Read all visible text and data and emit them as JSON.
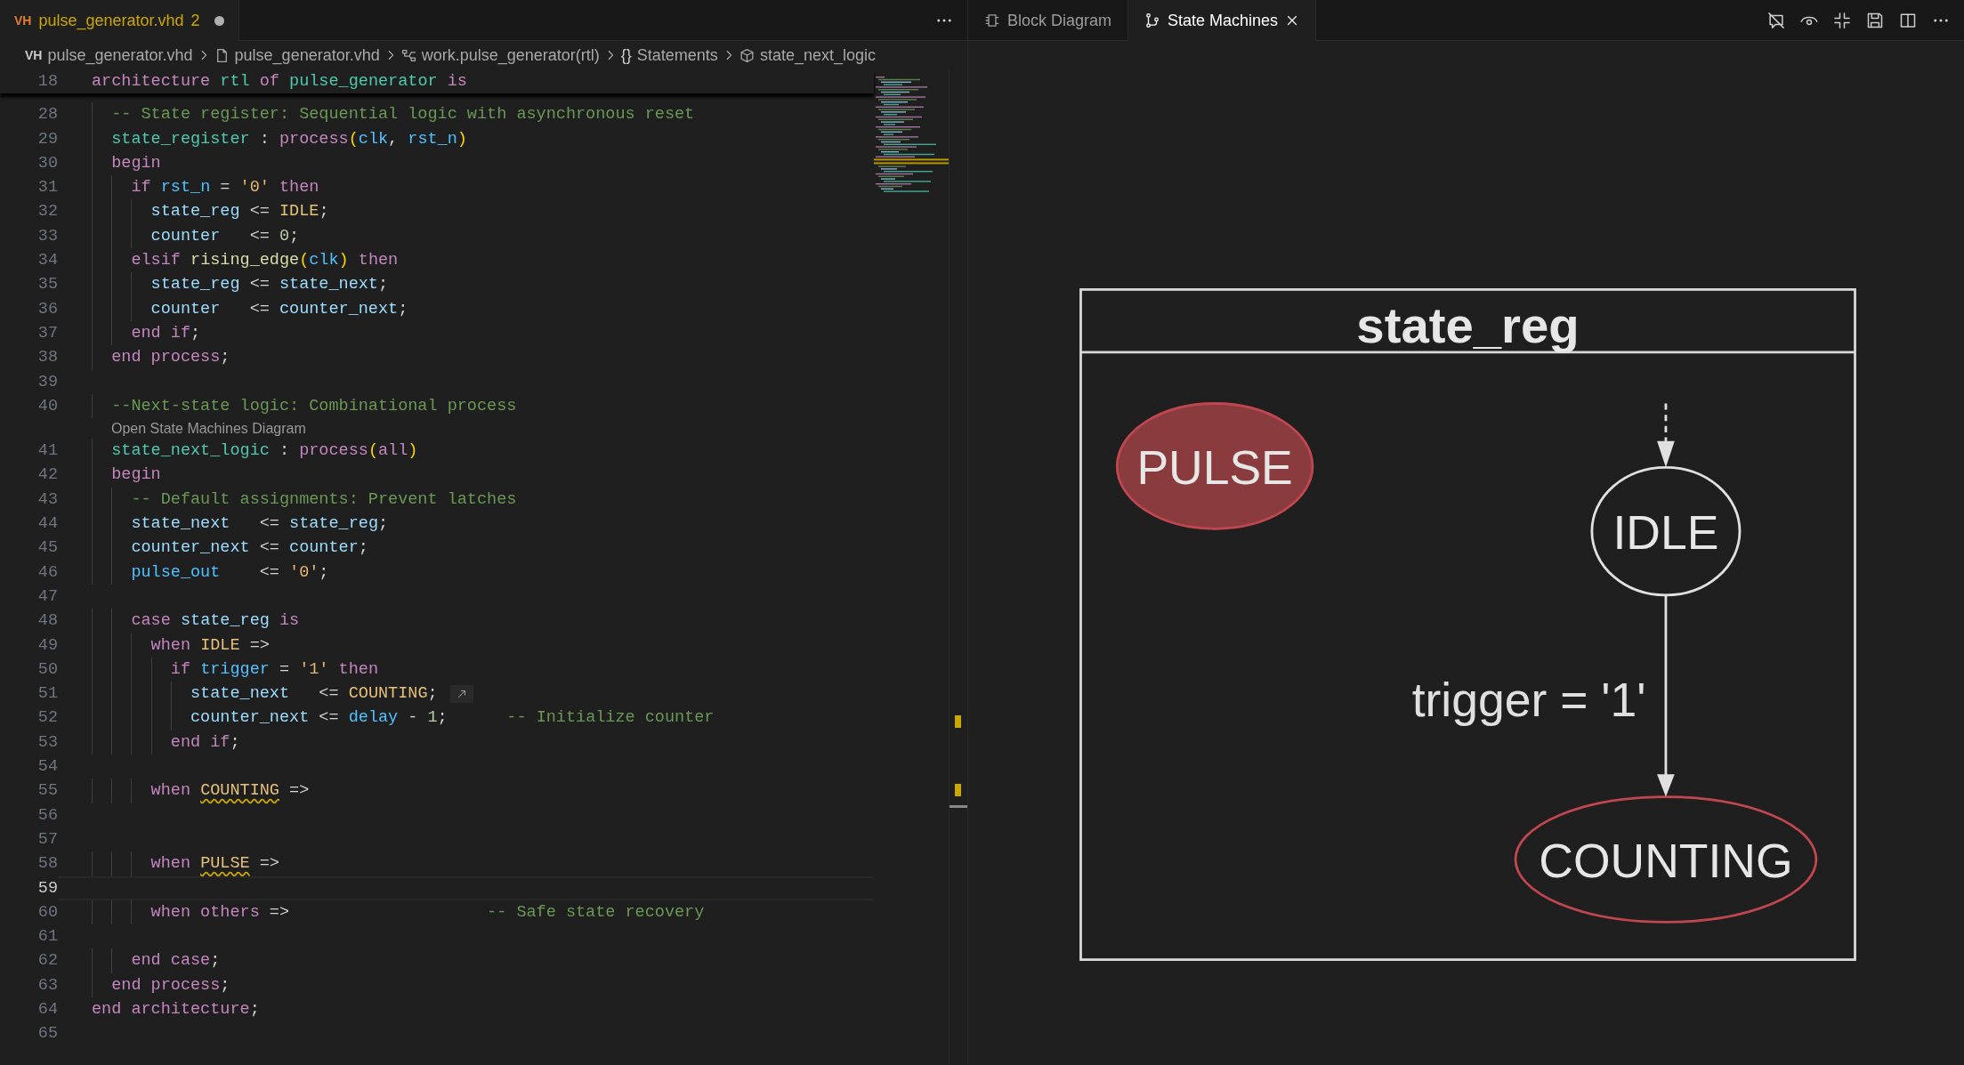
{
  "editor": {
    "tab": {
      "prefix": "VH",
      "title": "pulse_generator.vhd",
      "problems": "2",
      "modified": true,
      "selected": true
    },
    "breadcrumbs": [
      {
        "prefix": "VH",
        "label": "pulse_generator.vhd"
      },
      {
        "label": "pulse_generator.vhd"
      },
      {
        "label": "work.pulse_generator(rtl)"
      },
      {
        "prefix": "{}",
        "label": "Statements"
      },
      {
        "label": "state_next_logic"
      }
    ],
    "sticky_line": {
      "number": "18",
      "tokens": [
        {
          "kind": "kw",
          "text": "architecture "
        },
        {
          "kind": "name",
          "text": "rtl "
        },
        {
          "kind": "kw",
          "text": "of "
        },
        {
          "kind": "name",
          "text": "pulse_generator "
        },
        {
          "kind": "kw",
          "text": "is"
        }
      ]
    },
    "lines": [
      {
        "kind": "code",
        "number": "28",
        "tokens": [
          {
            "kind": "comment",
            "text": "  -- State register: Sequential logic with asynchronous reset"
          }
        ]
      },
      {
        "kind": "code",
        "number": "29",
        "tokens": [
          {
            "kind": "name",
            "text": "  state_register"
          },
          {
            "kind": "op",
            "text": " : "
          },
          {
            "kind": "kw",
            "text": "process"
          },
          {
            "kind": "paren",
            "text": "("
          },
          {
            "kind": "port",
            "text": "clk"
          },
          {
            "kind": "op",
            "text": ", "
          },
          {
            "kind": "port",
            "text": "rst_n"
          },
          {
            "kind": "paren",
            "text": ")"
          }
        ]
      },
      {
        "kind": "code",
        "number": "30",
        "tokens": [
          {
            "kind": "kw",
            "text": "  begin"
          }
        ]
      },
      {
        "kind": "code",
        "number": "31",
        "tokens": [
          {
            "kind": "kw",
            "text": "    if "
          },
          {
            "kind": "port",
            "text": "rst_n"
          },
          {
            "kind": "op",
            "text": " = "
          },
          {
            "kind": "lit",
            "text": "'0'"
          },
          {
            "kind": "kw",
            "text": " then"
          }
        ]
      },
      {
        "kind": "code",
        "number": "32",
        "tokens": [
          {
            "kind": "var",
            "text": "      state_reg"
          },
          {
            "kind": "op",
            "text": " <= "
          },
          {
            "kind": "const",
            "text": "IDLE"
          },
          {
            "kind": "op",
            "text": ";"
          }
        ]
      },
      {
        "kind": "code",
        "number": "33",
        "tokens": [
          {
            "kind": "var",
            "text": "      counter"
          },
          {
            "kind": "op",
            "text": "   <= "
          },
          {
            "kind": "num",
            "text": "0"
          },
          {
            "kind": "op",
            "text": ";"
          }
        ]
      },
      {
        "kind": "code",
        "number": "34",
        "tokens": [
          {
            "kind": "kw",
            "text": "    elsif "
          },
          {
            "kind": "func",
            "text": "rising_edge"
          },
          {
            "kind": "paren",
            "text": "("
          },
          {
            "kind": "port",
            "text": "clk"
          },
          {
            "kind": "paren",
            "text": ")"
          },
          {
            "kind": "kw",
            "text": " then"
          }
        ]
      },
      {
        "kind": "code",
        "number": "35",
        "tokens": [
          {
            "kind": "var",
            "text": "      state_reg"
          },
          {
            "kind": "op",
            "text": " <= "
          },
          {
            "kind": "var",
            "text": "state_next"
          },
          {
            "kind": "op",
            "text": ";"
          }
        ]
      },
      {
        "kind": "code",
        "number": "36",
        "tokens": [
          {
            "kind": "var",
            "text": "      counter"
          },
          {
            "kind": "op",
            "text": "   <= "
          },
          {
            "kind": "var",
            "text": "counter_next"
          },
          {
            "kind": "op",
            "text": ";"
          }
        ]
      },
      {
        "kind": "code",
        "number": "37",
        "tokens": [
          {
            "kind": "kw",
            "text": "    end if"
          },
          {
            "kind": "op",
            "text": ";"
          }
        ]
      },
      {
        "kind": "code",
        "number": "38",
        "tokens": [
          {
            "kind": "kw",
            "text": "  end process"
          },
          {
            "kind": "op",
            "text": ";"
          }
        ]
      },
      {
        "kind": "code",
        "number": "39"
      },
      {
        "kind": "code",
        "number": "40",
        "tokens": [
          {
            "kind": "comment",
            "text": "  --Next-state logic: Combinational process"
          }
        ]
      },
      {
        "kind": "codelens",
        "text": "Open State Machines Diagram"
      },
      {
        "kind": "code",
        "number": "41",
        "tokens": [
          {
            "kind": "name",
            "text": "  state_next_logic"
          },
          {
            "kind": "op",
            "text": " : "
          },
          {
            "kind": "kw",
            "text": "process"
          },
          {
            "kind": "paren",
            "text": "("
          },
          {
            "kind": "kw",
            "text": "all"
          },
          {
            "kind": "paren",
            "text": ")"
          }
        ]
      },
      {
        "kind": "code",
        "number": "42",
        "tokens": [
          {
            "kind": "kw",
            "text": "  begin"
          }
        ]
      },
      {
        "kind": "code",
        "number": "43",
        "tokens": [
          {
            "kind": "comment",
            "text": "    -- Default assignments: Prevent latches"
          }
        ]
      },
      {
        "kind": "code",
        "number": "44",
        "tokens": [
          {
            "kind": "var",
            "text": "    state_next"
          },
          {
            "kind": "op",
            "text": "   <= "
          },
          {
            "kind": "var",
            "text": "state_reg"
          },
          {
            "kind": "op",
            "text": ";"
          }
        ]
      },
      {
        "kind": "code",
        "number": "45",
        "tokens": [
          {
            "kind": "var",
            "text": "    counter_next"
          },
          {
            "kind": "op",
            "text": " <= "
          },
          {
            "kind": "var",
            "text": "counter"
          },
          {
            "kind": "op",
            "text": ";"
          }
        ]
      },
      {
        "kind": "code",
        "number": "46",
        "tokens": [
          {
            "kind": "port",
            "text": "    pulse_out"
          },
          {
            "kind": "op",
            "text": "    <= "
          },
          {
            "kind": "lit",
            "text": "'0'"
          },
          {
            "kind": "op",
            "text": ";"
          }
        ]
      },
      {
        "kind": "code",
        "number": "47"
      },
      {
        "kind": "code",
        "number": "48",
        "tokens": [
          {
            "kind": "kw",
            "text": "    case "
          },
          {
            "kind": "var",
            "text": "state_reg"
          },
          {
            "kind": "kw",
            "text": " is"
          }
        ]
      },
      {
        "kind": "code",
        "number": "49",
        "tokens": [
          {
            "kind": "kw",
            "text": "      when "
          },
          {
            "kind": "const",
            "text": "IDLE"
          },
          {
            "kind": "op",
            "text": " =>"
          }
        ]
      },
      {
        "kind": "code",
        "number": "50",
        "tokens": [
          {
            "kind": "kw",
            "text": "        if "
          },
          {
            "kind": "port",
            "text": "trigger"
          },
          {
            "kind": "op",
            "text": " = "
          },
          {
            "kind": "lit",
            "text": "'1'"
          },
          {
            "kind": "kw",
            "text": " then"
          }
        ]
      },
      {
        "kind": "code",
        "number": "51",
        "inline_hint": true,
        "tokens": [
          {
            "kind": "var",
            "text": "          state_next"
          },
          {
            "kind": "op",
            "text": "   <= "
          },
          {
            "kind": "const",
            "text": "COUNTING"
          },
          {
            "kind": "op",
            "text": ";"
          }
        ]
      },
      {
        "kind": "code",
        "number": "52",
        "tokens": [
          {
            "kind": "var",
            "text": "          counter_next"
          },
          {
            "kind": "op",
            "text": " <= "
          },
          {
            "kind": "port",
            "text": "delay"
          },
          {
            "kind": "op",
            "text": " - "
          },
          {
            "kind": "num",
            "text": "1"
          },
          {
            "kind": "op",
            "text": ";"
          },
          {
            "kind": "comment",
            "text": "      -- Initialize counter"
          }
        ]
      },
      {
        "kind": "code",
        "number": "53",
        "tokens": [
          {
            "kind": "kw",
            "text": "        end if"
          },
          {
            "kind": "op",
            "text": ";"
          }
        ]
      },
      {
        "kind": "code",
        "number": "54"
      },
      {
        "kind": "code",
        "number": "55",
        "tokens": [
          {
            "kind": "kw",
            "text": "      when "
          },
          {
            "kind": "const",
            "text": "COUNTING",
            "squiggle": true
          },
          {
            "kind": "op",
            "text": " =>"
          }
        ]
      },
      {
        "kind": "code",
        "number": "56"
      },
      {
        "kind": "code",
        "number": "57"
      },
      {
        "kind": "code",
        "number": "58",
        "tokens": [
          {
            "kind": "kw",
            "text": "      when "
          },
          {
            "kind": "const",
            "text": "PULSE",
            "squiggle": true
          },
          {
            "kind": "op",
            "text": " =>"
          }
        ]
      },
      {
        "kind": "code",
        "number": "59",
        "current": true
      },
      {
        "kind": "code",
        "number": "60",
        "tokens": [
          {
            "kind": "kw",
            "text": "      when others"
          },
          {
            "kind": "op",
            "text": " =>"
          },
          {
            "kind": "comment",
            "text": "                    -- Safe state recovery"
          }
        ]
      },
      {
        "kind": "code",
        "number": "61"
      },
      {
        "kind": "code",
        "number": "62",
        "tokens": [
          {
            "kind": "kw",
            "text": "    end case"
          },
          {
            "kind": "op",
            "text": ";"
          }
        ]
      },
      {
        "kind": "code",
        "number": "63",
        "tokens": [
          {
            "kind": "kw",
            "text": "  end process"
          },
          {
            "kind": "op",
            "text": ";"
          }
        ]
      },
      {
        "kind": "code",
        "number": "64",
        "tokens": [
          {
            "kind": "kw",
            "text": "end architecture"
          },
          {
            "kind": "op",
            "text": ";"
          }
        ]
      },
      {
        "kind": "code",
        "number": "65"
      }
    ]
  },
  "viewer": {
    "tabs": [
      {
        "label": "Block Diagram",
        "selected": false
      },
      {
        "label": "State Machines",
        "selected": true
      }
    ],
    "diagram": {
      "title": "state_reg",
      "states": [
        {
          "name": "PULSE",
          "kind": "unreachable"
        },
        {
          "name": "IDLE",
          "kind": "initial"
        },
        {
          "name": "COUNTING",
          "kind": "warning"
        }
      ],
      "transition": {
        "label": "trigger = '1'"
      }
    }
  }
}
